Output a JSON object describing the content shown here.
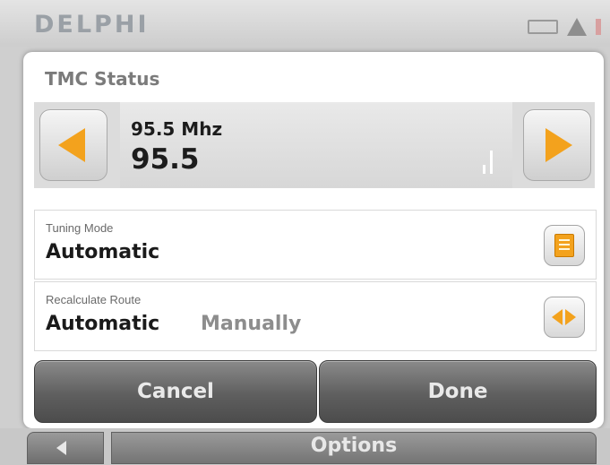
{
  "header": {
    "brand": "DELPHI",
    "icons": [
      "battery-icon",
      "warning-icon",
      "satellite-icon"
    ]
  },
  "dialog": {
    "title": "TMC Status",
    "frequency": {
      "label": "95.5 Mhz",
      "value": "95.5",
      "prev_icon": "arrow-left-icon",
      "next_icon": "arrow-right-icon"
    },
    "tuning_mode": {
      "label": "Tuning Mode",
      "value": "Automatic",
      "icon": "list-icon"
    },
    "recalculate_route": {
      "label": "Recalculate Route",
      "selected": "Automatic",
      "alternate": "Manually",
      "icon": "left-right-arrows-icon"
    },
    "buttons": {
      "cancel": "Cancel",
      "done": "Done"
    }
  },
  "footer": {
    "options": "Options",
    "back_icon": "back-arrow-icon"
  },
  "colors": {
    "accent": "#f3a21d",
    "button_dark": "#5f5f5f"
  }
}
